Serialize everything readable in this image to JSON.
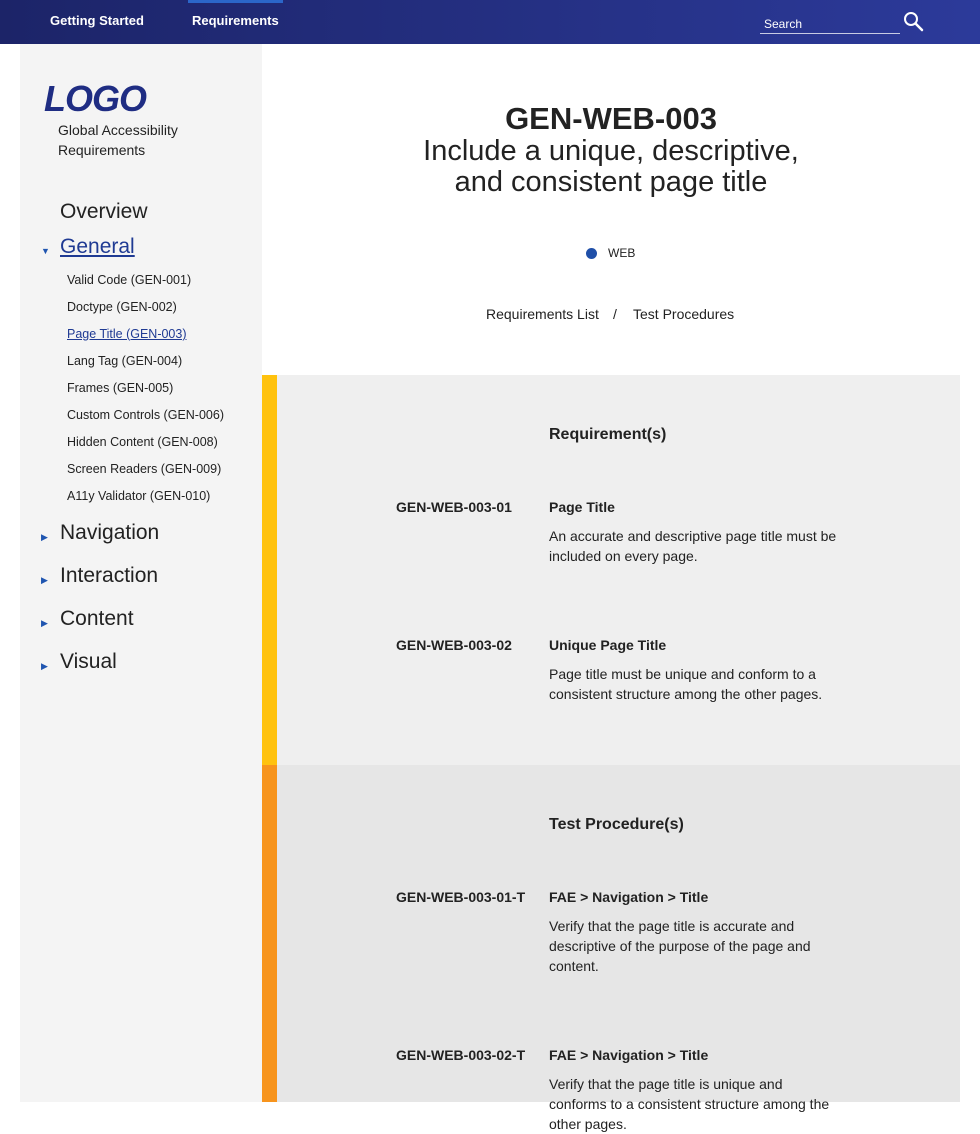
{
  "topnav": {
    "tabs": [
      {
        "label": "Getting Started"
      },
      {
        "label": "Requirements"
      }
    ],
    "search_placeholder": "Search",
    "search_icon": "search-icon"
  },
  "sidebar": {
    "logo": "LOGO",
    "subtitle": "Global Accessibility Requirements",
    "overview": "Overview",
    "general": "General",
    "general_items": [
      "Valid Code (GEN-001)",
      "Doctype (GEN-002)",
      "Page Title (GEN-003)",
      "Lang Tag (GEN-004)",
      "Frames (GEN-005)",
      "Custom Controls (GEN-006)",
      "Hidden Content (GEN-008)",
      "Screen Readers (GEN-009)",
      "A11y Validator (GEN-010)"
    ],
    "collapsed": [
      "Navigation",
      "Interaction",
      "Content",
      "Visual"
    ],
    "expanded_arrow": "▼",
    "collapsed_arrow": "▶"
  },
  "header": {
    "code": "GEN-WEB-003",
    "title": "Include a unique, descriptive, and consistent page title",
    "tag": "WEB",
    "tag_color": "#1f4fa8",
    "breadcrumb": [
      "Requirements List",
      "Test Procedures"
    ],
    "breadcrumb_sep": "/"
  },
  "requirements": {
    "heading": "Requirement(s)",
    "accent": "#ffc20e",
    "items": [
      {
        "id": "GEN-WEB-003-01",
        "title": "Page Title",
        "text": "An accurate and descriptive page title must be included on every page."
      },
      {
        "id": "GEN-WEB-003-02",
        "title": "Unique Page Title",
        "text": "Page title must be unique and conform to a consistent structure among the other pages."
      }
    ]
  },
  "tests": {
    "heading": "Test Procedure(s)",
    "accent": "#f7941d",
    "items": [
      {
        "id": "GEN-WEB-003-01-T",
        "title": "FAE > Navigation > Title",
        "text": "Verify that the page title is accurate and descriptive of the purpose of the page and content."
      },
      {
        "id": "GEN-WEB-003-02-T",
        "title": "FAE > Navigation > Title",
        "text": "Verify that the page title is unique and conforms to a consistent structure among the other pages."
      }
    ]
  }
}
